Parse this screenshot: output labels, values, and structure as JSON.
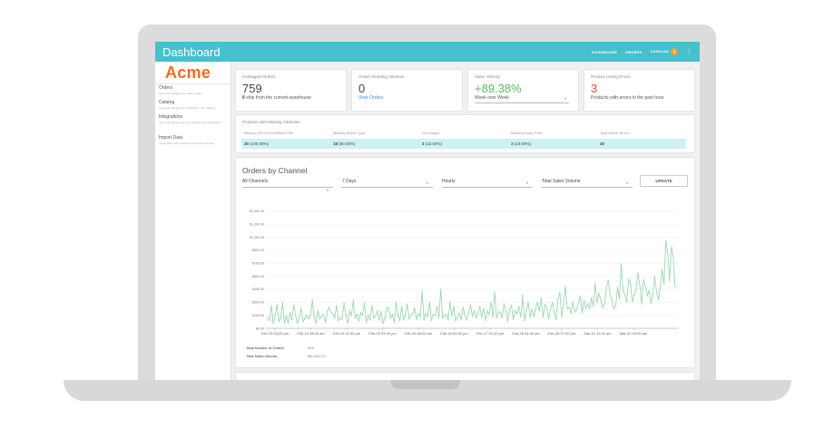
{
  "app": {
    "title": "Dashboard"
  },
  "nav": {
    "items": [
      "DASHBOARD",
      "ORDERS",
      "CATALOG"
    ],
    "catalog_badge": "3",
    "more_icon": "kebab-icon"
  },
  "sidebar": {
    "logo": "Acme",
    "items": [
      {
        "label": "Orders",
        "desc": "View and manage your sales orders"
      },
      {
        "label": "Catalog",
        "desc": "View and manage the products in your catalog"
      },
      {
        "label": "Integrations",
        "desc": "View and Manage all your services and integrations"
      },
      {
        "label": "Import Data",
        "desc": "Import data from external sources into Shoobi"
      }
    ]
  },
  "stats": [
    {
      "label": "Unshipped Orders",
      "value": "759",
      "sub_bold": "8",
      "sub": " ship from the current warehouse"
    },
    {
      "label": "Orders Needing Attention",
      "value": "0",
      "link": "View Orders"
    },
    {
      "label": "Sales Velocity",
      "value": "+89.38%",
      "select": "Week over Week"
    },
    {
      "label": "Product Listing Errors",
      "value": "3",
      "sub": "Products with errors in the past hour."
    }
  ],
  "missing": {
    "title": "Products with Missing Attributes",
    "headers": [
      "Missing UPC/EAN/ISBN/GTIN",
      "Missing Brand Type",
      "No Images",
      "Missing Sales Price",
      "Total Active SKUs"
    ],
    "row": [
      {
        "bold": "30",
        "rest": " (100.00%)"
      },
      {
        "bold": "18",
        "rest": " (60.00%)"
      },
      {
        "bold": "3",
        "rest": " (10.00%)"
      },
      {
        "bold": "3",
        "rest": " (10.00%)"
      },
      {
        "bold": "30",
        "rest": ""
      }
    ]
  },
  "orders_chart": {
    "title": "Orders by Channel",
    "filters": {
      "channel": "All Channels",
      "range": "7 Days",
      "interval": "Hourly",
      "metric": "Total Sales Volume"
    },
    "update_label": "UPDATE",
    "totals": [
      {
        "label": "Total Number of Orders:",
        "value": "648"
      },
      {
        "label": "Total Sales Volume:",
        "value": "$40,063.12"
      }
    ]
  },
  "colors": {
    "accent": "#46bfce",
    "brand": "#f26b21",
    "positive": "#5cb85c",
    "error": "#e74c3c",
    "line": "#9ad9b0"
  },
  "chart_data": {
    "type": "line",
    "title": "Orders by Channel",
    "xlabel": "",
    "ylabel": "",
    "ylim": [
      0,
      1400
    ],
    "yticks": [
      0,
      150,
      300,
      450,
      600,
      750,
      900,
      1050,
      1200,
      1350
    ],
    "ytick_labels": [
      "$0.00",
      "$150.00",
      "$300.00",
      "$450.00",
      "$600.00",
      "$750.00",
      "$900.00",
      "$1,050.00",
      "$1,200.00",
      "$1,350.00"
    ],
    "xtick_labels": [
      "Feb-23 03:00 pm",
      "Feb-24 08:00 am",
      "Feb-24 11:00 pm",
      "Feb-25 03:00 pm",
      "Feb-26 06:00 am",
      "Feb-26 09:00 pm",
      "Feb-27 01:00 pm",
      "Feb-28 04:00 am",
      "Feb-28 07:00 pm",
      "Mar-01 11:00 am",
      "Mar-02 03:00 am"
    ],
    "series": [
      {
        "values": [
          120,
          90,
          260,
          60,
          150,
          270,
          80,
          120,
          300,
          60,
          140,
          60,
          180,
          100,
          270,
          150,
          60,
          130,
          230,
          80,
          120,
          150,
          110,
          150,
          320,
          130,
          60,
          200,
          110,
          140,
          160,
          70,
          190,
          240,
          180,
          170,
          120,
          260,
          90,
          120,
          100,
          290,
          150,
          60,
          200,
          150,
          320,
          120,
          160,
          80,
          180,
          150,
          290,
          70,
          150,
          100,
          260,
          120,
          140,
          200,
          100,
          190,
          60,
          120,
          240,
          230,
          120,
          160,
          70,
          300,
          150,
          90,
          250,
          100,
          160,
          280,
          110,
          150,
          170,
          230,
          100,
          170,
          130,
          430,
          100,
          170,
          140,
          300,
          90,
          160,
          150,
          250,
          120,
          450,
          120,
          140,
          160,
          100,
          300,
          140,
          250,
          90,
          130,
          170,
          100,
          240,
          150,
          100,
          180,
          270,
          140,
          200,
          120,
          180,
          250,
          130,
          230,
          90,
          200,
          160,
          300,
          130,
          420,
          120,
          190,
          180,
          130,
          280,
          200,
          80,
          220,
          260,
          100,
          200,
          170,
          250,
          130,
          380,
          90,
          190,
          300,
          130,
          220,
          140,
          220,
          300,
          200,
          350,
          130,
          270,
          240,
          110,
          220,
          300,
          180,
          100,
          340,
          410,
          130,
          280,
          480,
          230,
          240,
          170,
          300,
          190,
          210,
          290,
          370,
          180,
          320,
          230,
          280,
          230,
          350,
          260,
          520,
          300,
          400,
          330,
          240,
          280,
          460,
          550,
          390,
          320,
          230,
          250,
          470,
          340,
          740,
          440,
          380,
          300,
          560,
          520,
          310,
          380,
          450,
          640,
          500,
          280,
          560,
          480,
          380,
          430,
          290,
          380,
          600,
          420,
          330,
          480,
          680,
          510,
          1010,
          870,
          550,
          940,
          820,
          470
        ]
      }
    ]
  }
}
